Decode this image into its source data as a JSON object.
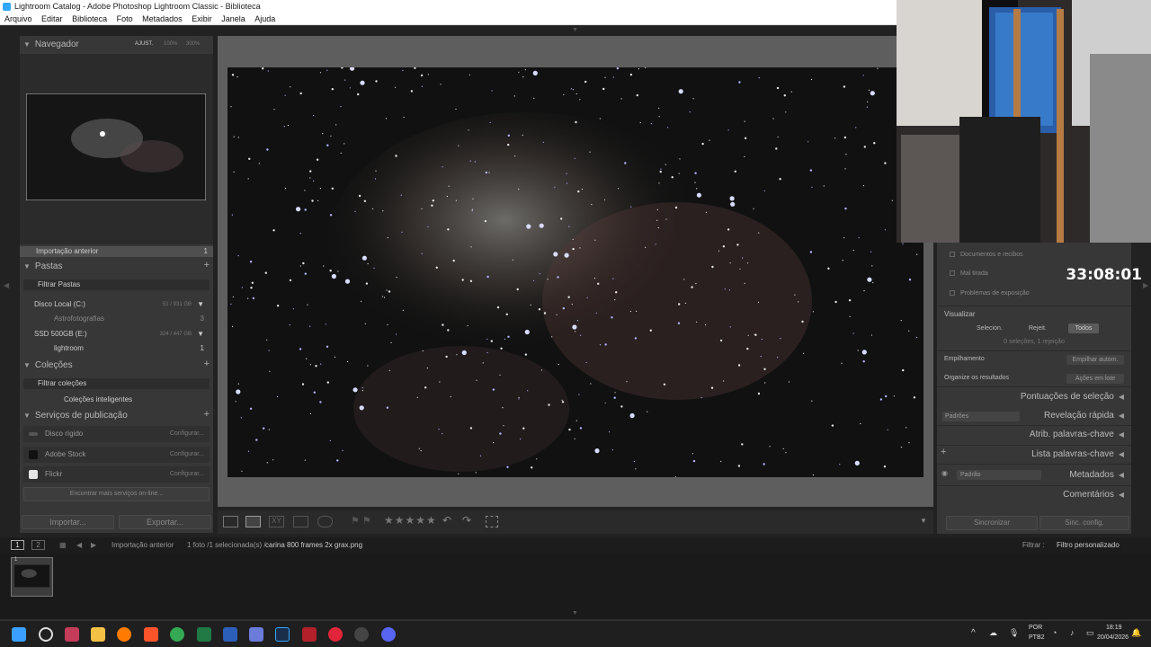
{
  "window": {
    "title": "Lightroom Catalog - Adobe Photoshop Lightroom Classic - Biblioteca"
  },
  "menu": [
    "Arquivo",
    "Editar",
    "Biblioteca",
    "Foto",
    "Metadados",
    "Exibir",
    "Janela",
    "Ajuda"
  ],
  "navigator": {
    "title": "Navegador",
    "zoom_fit": "AJUST.",
    "zoom_100": "100%",
    "zoom_300": "300%"
  },
  "catalog": {
    "previous_import": "Importação anterior",
    "count": "1"
  },
  "folders": {
    "title": "Pastas",
    "filter": "Filtrar Pastas",
    "disk_c": {
      "name": "Disco Local (C:)",
      "size": "51 / 931 GB"
    },
    "astro": {
      "name": "Astrofotografias",
      "count": "3"
    },
    "ssd": {
      "name": "SSD 500GB (E:)",
      "size": "324 / 447 GB"
    },
    "lightroom": {
      "name": "lightroom",
      "count": "1"
    }
  },
  "collections": {
    "title": "Coleções",
    "filter": "Filtrar coleções",
    "smart": "Coleções inteligentes"
  },
  "publish": {
    "title": "Serviços de publicação",
    "services": [
      {
        "name": "Disco rígido",
        "action": "Configurar..."
      },
      {
        "name": "Adobe Stock",
        "action": "Configurar..."
      },
      {
        "name": "Flickr",
        "action": "Configurar..."
      }
    ],
    "more": "Encontrar mais serviços on-line..."
  },
  "buttons": {
    "import": "Importar...",
    "export": "Exportar...",
    "sync": "Sincronizar",
    "sync_settings": "Sinc. config."
  },
  "right": {
    "items": [
      "Documentos e recibos",
      "Mal tirada",
      "Problemas de exposição"
    ],
    "view_title": "Visualizar",
    "view_options": [
      "Selecion.",
      "Rejeit.",
      "Todos"
    ],
    "summary": "0 seleções, 1 rejeição",
    "stack_label": "Empilhamento",
    "stack_btn": "Empilhar autom.",
    "organize_label": "Organize os resultados",
    "organize_btn": "Ações em lote",
    "sections": [
      "Pontuações de seleção",
      "Revelação rápida",
      "Atrib. palavras-chave",
      "Lista palavras-chave",
      "Metadados",
      "Comentários"
    ],
    "quick_preset": "Padrões",
    "meta_preset": "Padrão"
  },
  "timer": "33:08:01",
  "filmstrip": {
    "page1": "1",
    "page2": "2",
    "source": "Importação anterior",
    "info": "1 foto /1 selecionada(s) /",
    "file": "carina 800 frames 2x grax.png",
    "filter_label": "Filtrar :",
    "filter_value": "Filtro personalizado",
    "thumb_index": "1"
  },
  "taskbar": {
    "lang1": "POR",
    "lang2": "PTB2",
    "time": "18:19",
    "date": "20/04/2026"
  },
  "colors": {
    "accent_lr": "#31a8ff",
    "panel": "#373737",
    "center": "#5e5e5e"
  }
}
